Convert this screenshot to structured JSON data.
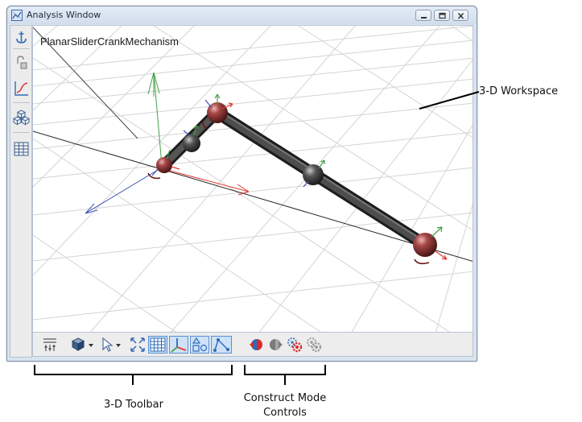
{
  "window": {
    "title": "Analysis Window"
  },
  "viewport": {
    "model_name": "PlanarSliderCrankMechanism"
  },
  "left_toolbar": {
    "icons": [
      "anchor-icon",
      "lock-joint-icon",
      "plot-icon",
      "bodies-icon",
      "table-icon"
    ]
  },
  "bottom_toolbar": {
    "icons": [
      "settings-icon",
      "view-cube-icon",
      "pointer-icon",
      "zoom-fit-icon",
      "grid-icon",
      "axes-icon",
      "shapes-icon",
      "path-icon"
    ],
    "construct_icons": [
      "construct-mode-a-icon",
      "construct-mode-b-icon",
      "construct-gear-a-icon",
      "construct-gear-b-icon"
    ]
  },
  "callouts": {
    "workspace": "3-D Workspace",
    "toolbar": "3-D Toolbar",
    "construct_line1": "Construct Mode",
    "construct_line2": "Controls"
  },
  "colors": {
    "axis_x": "#e53935",
    "axis_y": "#43a047",
    "axis_z": "#3f51b5",
    "joint": "#8b3a3a",
    "link": "#444444",
    "selected": "#cde1f7"
  }
}
